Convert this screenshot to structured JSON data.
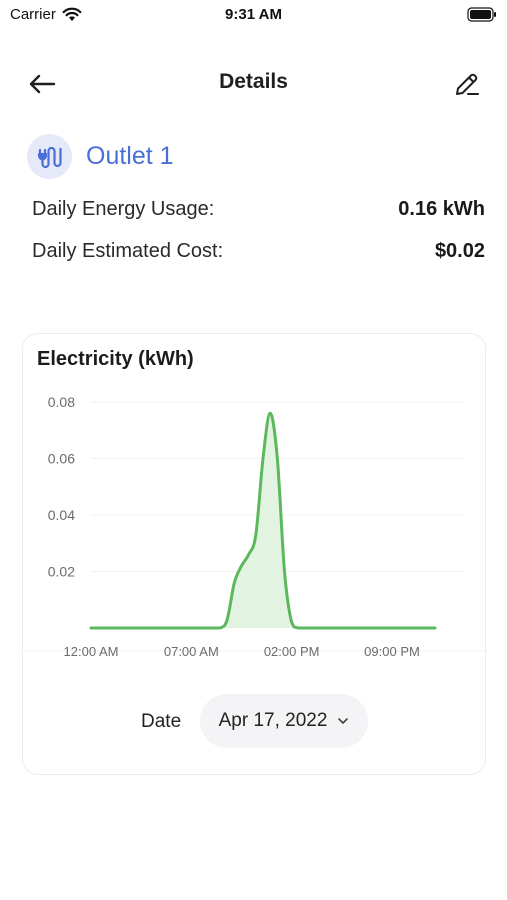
{
  "status_bar": {
    "carrier": "Carrier",
    "time": "9:31 AM"
  },
  "nav": {
    "title": "Details"
  },
  "device": {
    "name": "Outlet 1"
  },
  "stats": [
    {
      "label": "Daily Energy Usage:",
      "value": "0.16 kWh"
    },
    {
      "label": "Daily Estimated Cost:",
      "value": "$0.02"
    }
  ],
  "colors": {
    "accent": "#4a6fd6",
    "line": "#5cb85c",
    "fill": "#e3f3e1",
    "icon_bg": "#e6e9f8"
  },
  "chart_data": {
    "type": "area",
    "title": "Electricity (kWh)",
    "xlabel": "",
    "ylabel": "",
    "y_ticks": [
      "0.08",
      "0.06",
      "0.04",
      "0.02"
    ],
    "y_tick_values": [
      0.08,
      0.06,
      0.04,
      0.02
    ],
    "ylim": [
      0,
      0.08
    ],
    "x_ticks": [
      "12:00 AM",
      "07:00 AM",
      "02:00 PM",
      "09:00 PM"
    ],
    "x_tick_hours": [
      0,
      7,
      14,
      21
    ],
    "xlim": [
      0,
      24
    ],
    "grid": true,
    "series": [
      {
        "x": [
          0,
          2,
          4,
          6,
          8,
          9,
          9.5,
          10,
          10.5,
          11,
          11.5,
          12,
          12.5,
          13,
          13.5,
          14,
          14.5,
          16,
          18,
          20,
          22,
          24
        ],
        "y": [
          0,
          0,
          0,
          0,
          0,
          0,
          0.003,
          0.016,
          0.022,
          0.026,
          0.033,
          0.06,
          0.076,
          0.06,
          0.02,
          0.002,
          0,
          0,
          0,
          0,
          0,
          0
        ]
      }
    ]
  },
  "date": {
    "label": "Date",
    "value": "Apr 17, 2022"
  }
}
